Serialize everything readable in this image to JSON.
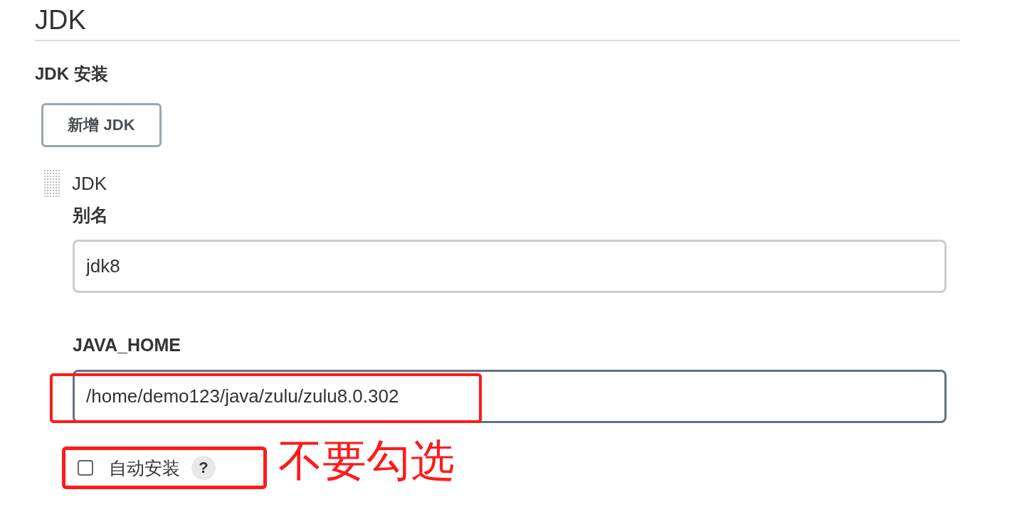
{
  "heading": "JDK",
  "section_title": "JDK 安装",
  "add_button": "新增 JDK",
  "jdk": {
    "title": "JDK",
    "fields": [
      {
        "label": "别名",
        "value": "jdk8",
        "focused": false,
        "annotated": false
      },
      {
        "label": "JAVA_HOME",
        "value": "/home/demo123/java/zulu/zulu8.0.302",
        "focused": true,
        "annotated": true
      }
    ]
  },
  "auto_install": {
    "label": "自动安装",
    "checked": false,
    "help": "?"
  },
  "annotation": "不要勾选"
}
